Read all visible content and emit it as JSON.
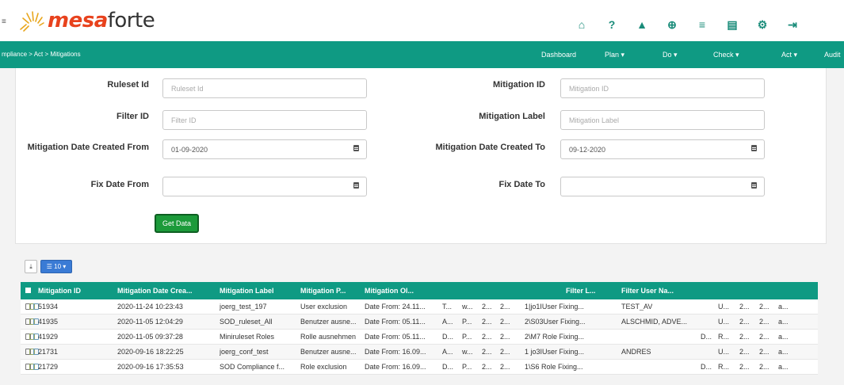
{
  "header": {
    "brand_bold": "mesa",
    "brand_light": "forte",
    "icons": [
      "home-icon",
      "help-icon",
      "user-icon",
      "globe-icon",
      "list-icon",
      "clipboard-icon",
      "gear-icon",
      "logout-icon"
    ],
    "icon_glyphs": [
      "⌂",
      "?",
      "▲",
      "⊕",
      "≡",
      "▤",
      "⚙",
      "⇥"
    ]
  },
  "nav": {
    "breadcrumb": "mpliance > Act > Mitigations",
    "items": [
      "Dashboard",
      "Plan ▾",
      "Do ▾",
      "Check ▾",
      "Act ▾",
      "Audit"
    ]
  },
  "form": {
    "ruleset_id_label": "Ruleset Id",
    "ruleset_id_placeholder": "Ruleset Id",
    "mitigation_id_label": "Mitigation ID",
    "mitigation_id_placeholder": "Mitigation ID",
    "filter_id_label": "Filter ID",
    "filter_id_placeholder": "Filter ID",
    "mitigation_label_label": "Mitigation Label",
    "mitigation_label_placeholder": "Mitigation Label",
    "date_from_label": "Mitigation Date Created From",
    "date_from_value": "01-09-2020",
    "date_to_label": "Mitigation Date Created To",
    "date_to_value": "09-12-2020",
    "fix_from_label": "Fix Date From",
    "fix_from_value": "",
    "fix_to_label": "Fix Date To",
    "fix_to_value": "",
    "get_data": "Get Data"
  },
  "toolbar": {
    "export_glyph": "⤓",
    "page_size": "☰ 10 ▾"
  },
  "table": {
    "columns": [
      "Mitigation ID",
      "Mitigation Date Crea...",
      "Mitigation Label",
      "Mitigation P...",
      "Mitigation Ol...",
      "Filter L...",
      "Filter User Na..."
    ],
    "rows": [
      {
        "id": "51934",
        "date": "2020-11-24 10:23:43",
        "label": "joerg_test_197",
        "p": "User exclusion",
        "ol": "Date From: 24.11...",
        "c1": "T...",
        "c2": "w...",
        "c3": "2...",
        "c4": "2...",
        "filter": "1|jo1IUser Fixing...",
        "user": "TEST_AV",
        "c5": "",
        "c6": "U...",
        "c7": "2...",
        "c8": "2...",
        "c9": "a..."
      },
      {
        "id": "41935",
        "date": "2020-11-05 12:04:29",
        "label": "SOD_ruleset_All",
        "p": "Benutzer ausne...",
        "ol": "Date From: 05.11...",
        "c1": "A...",
        "c2": "P...",
        "c3": "2...",
        "c4": "2...",
        "filter": "2\\S03User Fixing...",
        "user": "ALSCHMID, ADVE...",
        "c5": "",
        "c6": "U...",
        "c7": "2...",
        "c8": "2...",
        "c9": "a..."
      },
      {
        "id": "41929",
        "date": "2020-11-05 09:37:28",
        "label": "Miniruleset Roles",
        "p": "Rolle ausnehmen",
        "ol": "Date From: 05.11...",
        "c1": "D...",
        "c2": "P...",
        "c3": "2...",
        "c4": "2...",
        "filter": "2\\M7 Role Fixing...",
        "user": "",
        "c5": "D...",
        "c6": "R...",
        "c7": "2...",
        "c8": "2...",
        "c9": "a..."
      },
      {
        "id": "21731",
        "date": "2020-09-16 18:22:25",
        "label": "joerg_conf_test",
        "p": "Benutzer ausne...",
        "ol": "Date From: 16.09...",
        "c1": "A...",
        "c2": "w...",
        "c3": "2...",
        "c4": "2...",
        "filter": "1 jo3IUser Fixing...",
        "user": "ANDRES",
        "c5": "",
        "c6": "U...",
        "c7": "2...",
        "c8": "2...",
        "c9": "a..."
      },
      {
        "id": "21729",
        "date": "2020-09-16 17:35:53",
        "label": "SOD Compliance f...",
        "p": "Role exclusion",
        "ol": "Date From: 16.09...",
        "c1": "D...",
        "c2": "P...",
        "c3": "2...",
        "c4": "2...",
        "filter": "1\\S6 Role Fixing...",
        "user": "",
        "c5": "D...",
        "c6": "R...",
        "c7": "2...",
        "c8": "2...",
        "c9": "a..."
      }
    ]
  },
  "colors": {
    "brand_green": "#0f9a83",
    "logo_orange": "#e8421d",
    "button_green": "#1c9a3a",
    "page_size_blue": "#3a7bd5"
  }
}
